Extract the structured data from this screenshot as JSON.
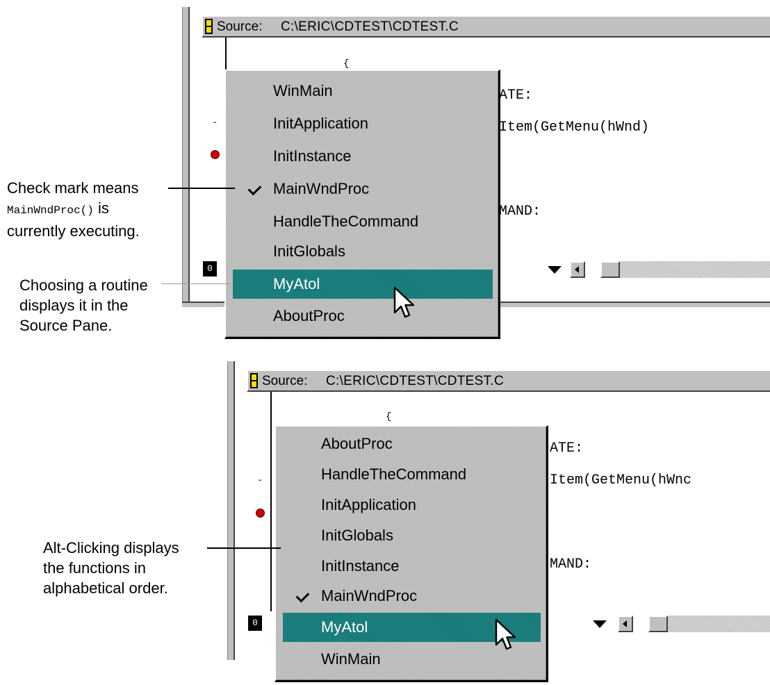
{
  "panel_top": {
    "title_label": "Source:",
    "path": "C:\\ERIC\\CDTEST\\CDTEST.C",
    "code_lines": [
      "ATE:",
      "Item(GetMenu(hWnd)",
      "MAND:"
    ],
    "status_icon": "0",
    "menu_items": [
      {
        "label": "WinMain",
        "checked": false,
        "selected": false
      },
      {
        "label": "InitApplication",
        "checked": false,
        "selected": false
      },
      {
        "label": "InitInstance",
        "checked": false,
        "selected": false
      },
      {
        "label": "MainWndProc",
        "checked": true,
        "selected": false
      },
      {
        "label": "HandleTheCommand",
        "checked": false,
        "selected": false
      },
      {
        "label": "InitGlobals",
        "checked": false,
        "selected": false
      },
      {
        "label": "MyAtol",
        "checked": false,
        "selected": true
      },
      {
        "label": "AboutProc",
        "checked": false,
        "selected": false
      }
    ]
  },
  "panel_bottom": {
    "title_label": "Source:",
    "path": "C:\\ERIC\\CDTEST\\CDTEST.C",
    "code_lines": [
      "ATE:",
      "Item(GetMenu(hWnc",
      "MAND:"
    ],
    "status_icon": "0",
    "menu_items": [
      {
        "label": "AboutProc",
        "checked": false,
        "selected": false
      },
      {
        "label": "HandleTheCommand",
        "checked": false,
        "selected": false
      },
      {
        "label": "InitApplication",
        "checked": false,
        "selected": false
      },
      {
        "label": "InitGlobals",
        "checked": false,
        "selected": false
      },
      {
        "label": "InitInstance",
        "checked": false,
        "selected": false
      },
      {
        "label": "MainWndProc",
        "checked": true,
        "selected": false
      },
      {
        "label": "MyAtol",
        "checked": false,
        "selected": true
      },
      {
        "label": "WinMain",
        "checked": false,
        "selected": false
      }
    ]
  },
  "annotations": {
    "check_mark_line1": "Check mark means",
    "check_mark_code": "MainWndProc()",
    "check_mark_is": "is",
    "check_mark_line3": "currently executing.",
    "choosing_line1": "Choosing a routine",
    "choosing_line2": "displays it in the",
    "choosing_line3": "Source Pane.",
    "alt_line1": "Alt-Clicking displays",
    "alt_line2": "the functions in",
    "alt_line3": "alphabetical order."
  },
  "colors": {
    "selection": "#157a78",
    "breakpoint": "#cc0000",
    "window_gray": "#c0c0c0"
  }
}
